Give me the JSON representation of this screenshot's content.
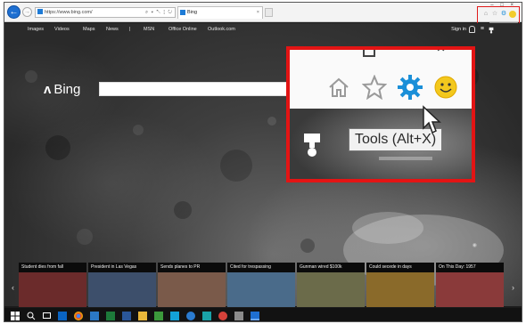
{
  "browser": {
    "url": "https://www.bing.com/",
    "tab_title": "Bing",
    "back_icon": "arrow-left-icon",
    "forward_icon": "arrow-right-icon",
    "address_tools": "⌕ ▾ ↖ ¦ ↻",
    "tab_close": "×",
    "window_controls": "– □ ×",
    "toolbar_icons": [
      "home-icon",
      "star-icon",
      "gear-icon",
      "smiley-icon"
    ],
    "tools_tooltip": "Tools (Alt+X)"
  },
  "bing": {
    "logo_text": "Bing",
    "nav": [
      "Images",
      "Videos",
      "Maps",
      "News",
      "|",
      "MSN",
      "Office Online",
      "Outlook.com"
    ],
    "sign_in": "Sign in",
    "menu_glyph": "≡",
    "camera_glyph": "◉"
  },
  "zoom": {
    "tooltip": "Tools (Alt+X)"
  },
  "news": [
    {
      "caption": "Student dies from fall",
      "color": "#6b2b2b"
    },
    {
      "caption": "President in Las Vegas",
      "color": "#3d4f6b"
    },
    {
      "caption": "Sends planes to PR",
      "color": "#7a5a4a"
    },
    {
      "caption": "Cited for trespassing",
      "color": "#4a6b8a"
    },
    {
      "caption": "Gunman wired $100k",
      "color": "#6b6b4a"
    },
    {
      "caption": "Could secede in days",
      "color": "#8a6a2a"
    },
    {
      "caption": "On This Day: 1957",
      "color": "#8a3a3a"
    }
  ],
  "news_arrows": {
    "left": "‹",
    "right": "›"
  },
  "taskbar": [
    "windows-icon",
    "search-icon",
    "task-view-icon",
    "outlook-icon",
    "chrome-icon",
    "file-explorer-icon",
    "excel-icon",
    "word-icon",
    "folder-icon",
    "ppt-icon",
    "skype-icon",
    "teams-icon",
    "app-icon",
    "paint-icon",
    "network-icon",
    "edge-icon"
  ]
}
